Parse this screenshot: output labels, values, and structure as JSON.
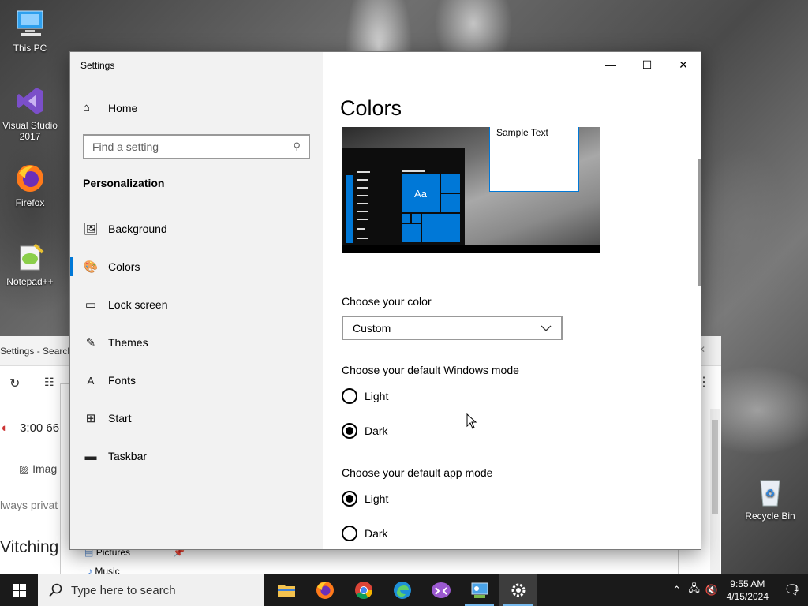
{
  "desktop": {
    "icons": [
      {
        "label": "This PC"
      },
      {
        "label": "Visual Studio 2017"
      },
      {
        "label": "Firefox"
      },
      {
        "label": "Notepad++"
      },
      {
        "label": "Recycle Bin"
      }
    ]
  },
  "background_windows": {
    "browser_title": "Settings - Search",
    "browser_timer": "3:00 66",
    "browser_tab_images": "Imag",
    "browser_private": "lways privat",
    "browser_heading": "Vitching",
    "explorer_items": [
      "Pictures",
      "Music"
    ]
  },
  "settings": {
    "window_title": "Settings",
    "sidebar": {
      "home_label": "Home",
      "search_placeholder": "Find a setting",
      "section": "Personalization",
      "items": [
        {
          "label": "Background",
          "icon": "picture-icon",
          "active": false
        },
        {
          "label": "Colors",
          "icon": "palette-icon",
          "active": true
        },
        {
          "label": "Lock screen",
          "icon": "lock-screen-icon",
          "active": false
        },
        {
          "label": "Themes",
          "icon": "brush-icon",
          "active": false
        },
        {
          "label": "Fonts",
          "icon": "font-icon",
          "active": false
        },
        {
          "label": "Start",
          "icon": "start-icon",
          "active": false
        },
        {
          "label": "Taskbar",
          "icon": "taskbar-icon",
          "active": false
        }
      ]
    },
    "main": {
      "title": "Colors",
      "preview_sample_text": "Sample Text",
      "preview_tile_text": "Aa",
      "choose_color_label": "Choose your color",
      "choose_color_value": "Custom",
      "windows_mode_label": "Choose your default Windows mode",
      "windows_mode_options": [
        "Light",
        "Dark"
      ],
      "windows_mode_selected": "Dark",
      "app_mode_label": "Choose your default app mode",
      "app_mode_options": [
        "Light",
        "Dark"
      ],
      "app_mode_selected": "Light"
    },
    "accent_color": "#0078d7"
  },
  "taskbar": {
    "search_placeholder": "Type here to search",
    "apps": [
      "file-explorer-icon",
      "firefox-icon",
      "chrome-icon",
      "edge-icon",
      "visual-studio-icon",
      "control-panel-icon",
      "settings-icon"
    ],
    "time": "9:55 AM",
    "date": "4/15/2024",
    "notification_count": "1"
  }
}
